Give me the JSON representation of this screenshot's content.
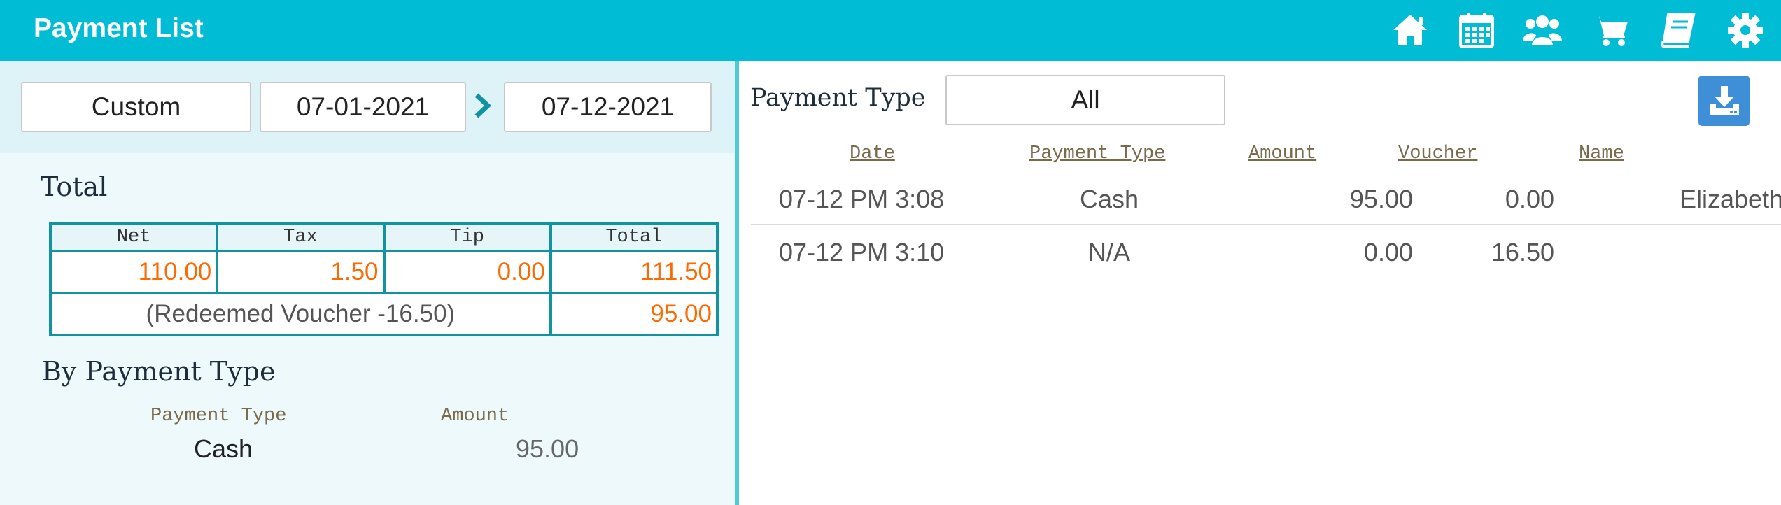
{
  "header": {
    "title": "Payment List",
    "icons": [
      "home-icon",
      "calendar-icon",
      "users-icon",
      "cart-icon",
      "book-icon",
      "gear-icon"
    ]
  },
  "date_range": {
    "period": "Custom",
    "from": "07-01-2021",
    "to": "07-12-2021"
  },
  "totals": {
    "title": "Total",
    "headers": [
      "Net",
      "Tax",
      "Tip",
      "Total"
    ],
    "values": [
      "110.00",
      "1.50",
      "0.00",
      "111.50"
    ],
    "voucher_note": "(Redeemed Voucher -16.50)",
    "final_total": "95.00"
  },
  "by_payment_type": {
    "title": "By Payment Type",
    "col_type": "Payment Type",
    "col_amount": "Amount",
    "rows": [
      {
        "type": "Cash",
        "amount": "95.00"
      }
    ]
  },
  "filter": {
    "label": "Payment Type",
    "value": "All"
  },
  "payments": {
    "headers": {
      "date": "Date",
      "payment_type": "Payment Type",
      "amount": "Amount",
      "voucher": "Voucher",
      "name": "Name"
    },
    "rows": [
      {
        "date": "07-12 PM 3:08",
        "payment_type": "Cash",
        "amount": "95.00",
        "voucher": "0.00",
        "name": "Elizabeth Wilson"
      },
      {
        "date": "07-12 PM 3:10",
        "payment_type": "N/A",
        "amount": "0.00",
        "voucher": "16.50",
        "name": ""
      }
    ]
  },
  "colors": {
    "header_bg": "#00bcd4",
    "accent_number": "#ff6a00",
    "table_border": "#11949e",
    "download_button": "#3f8fd8"
  }
}
